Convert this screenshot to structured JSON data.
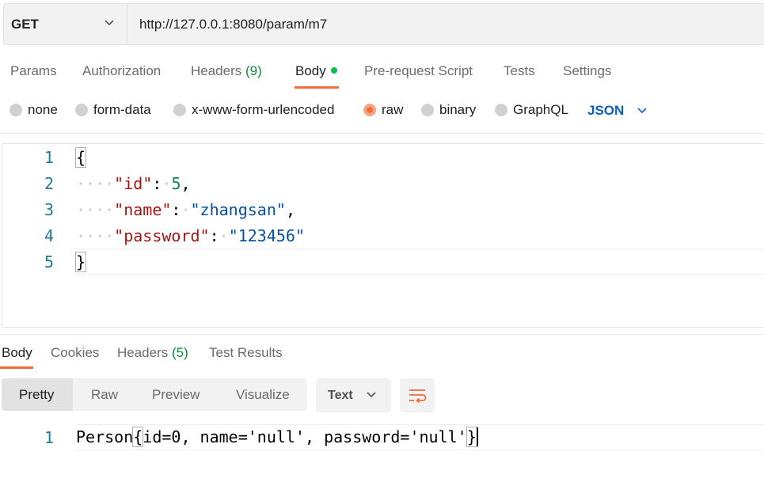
{
  "request": {
    "method": "GET",
    "url": "http://127.0.0.1:8080/param/m7"
  },
  "tabs": {
    "params": "Params",
    "authorization": "Authorization",
    "headers": "Headers",
    "headers_count": "(9)",
    "body": "Body",
    "prerequest": "Pre-request Script",
    "tests": "Tests",
    "settings": "Settings"
  },
  "body_types": {
    "none": "none",
    "form_data": "form-data",
    "urlencoded": "x-www-form-urlencoded",
    "raw": "raw",
    "binary": "binary",
    "graphql": "GraphQL",
    "selected": "raw",
    "language": "JSON"
  },
  "editor": {
    "lines": [
      "1",
      "2",
      "3",
      "4",
      "5"
    ],
    "open_brace": "{",
    "close_brace": "}",
    "key_id": "\"id\"",
    "val_id": "5",
    "key_name": "\"name\"",
    "val_name": "\"zhangsan\"",
    "key_password": "\"password\"",
    "val_password": "\"123456\""
  },
  "response": {
    "tabs": {
      "body": "Body",
      "cookies": "Cookies",
      "headers": "Headers",
      "headers_count": "(5)",
      "test_results": "Test Results"
    },
    "views": {
      "pretty": "Pretty",
      "raw": "Raw",
      "preview": "Preview",
      "visualize": "Visualize"
    },
    "format": "Text",
    "line_number": "1",
    "text_prefix": "Person",
    "text_body": "id=0, name='null', password='null'"
  },
  "colors": {
    "accent_orange": "#f26b3a",
    "status_green": "#0cbb52",
    "json_blue": "#0b5fc1"
  },
  "icons": [
    "chevron-down-icon",
    "wrap-lines-icon"
  ]
}
